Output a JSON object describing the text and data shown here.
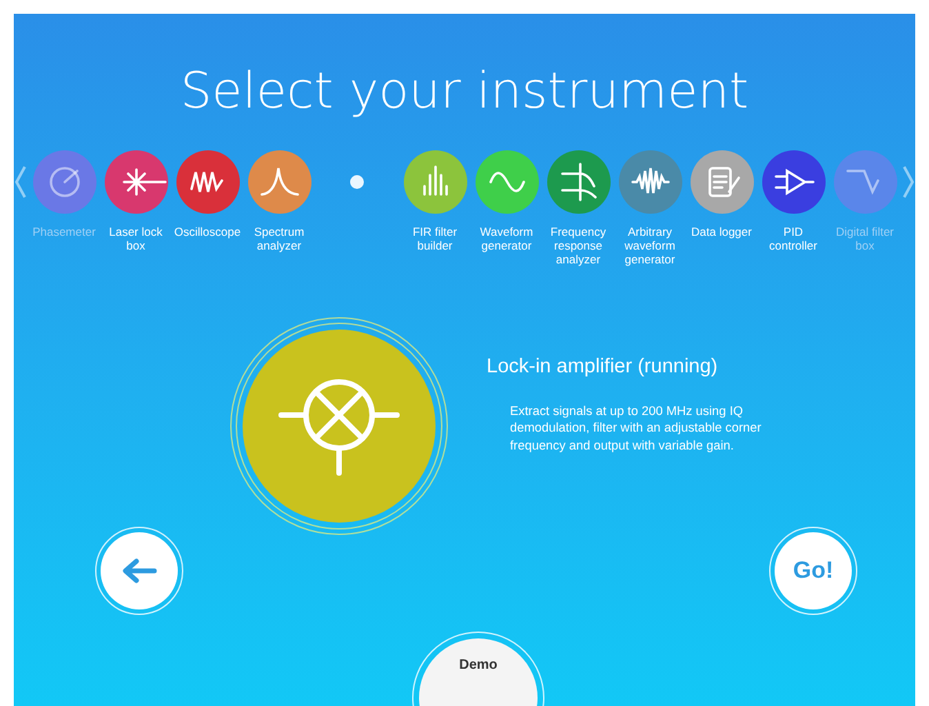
{
  "title": "Select your instrument",
  "instruments": [
    {
      "kind": "instrument",
      "label": "Phasemeter",
      "color": "#6a78e6",
      "dimmed": true
    },
    {
      "kind": "instrument",
      "label": "Laser lock box",
      "color": "#d8386e",
      "dimmed": false
    },
    {
      "kind": "instrument",
      "label": "Oscilloscope",
      "color": "#d9303a",
      "dimmed": false
    },
    {
      "kind": "instrument",
      "label": "Spectrum analyzer",
      "color": "#de8a4a",
      "dimmed": false
    },
    {
      "kind": "placeholder"
    },
    {
      "kind": "instrument",
      "label": "FIR filter builder",
      "color": "#8cc43c",
      "dimmed": false
    },
    {
      "kind": "instrument",
      "label": "Waveform generator",
      "color": "#3fcf4a",
      "dimmed": false
    },
    {
      "kind": "instrument",
      "label": "Frequency response analyzer",
      "color": "#1d9a4e",
      "dimmed": false
    },
    {
      "kind": "instrument",
      "label": "Arbitrary waveform generator",
      "color": "#4a8aa8",
      "dimmed": false
    },
    {
      "kind": "instrument",
      "label": "Data logger",
      "color": "#a8a8a8",
      "dimmed": false
    },
    {
      "kind": "instrument",
      "label": "PID controller",
      "color": "#3a3ee0",
      "dimmed": false
    },
    {
      "kind": "instrument",
      "label": "Digital filter box",
      "color": "#5a86ea",
      "dimmed": true
    }
  ],
  "current": {
    "name": "Lock-in amplifier (running)",
    "description": "Extract signals at up to 200 MHz using IQ demodulation, filter with an adjustable corner frequency and output with variable gain.",
    "color": "#c9c21e"
  },
  "go_button": "Go!",
  "demo_button": "Demo"
}
